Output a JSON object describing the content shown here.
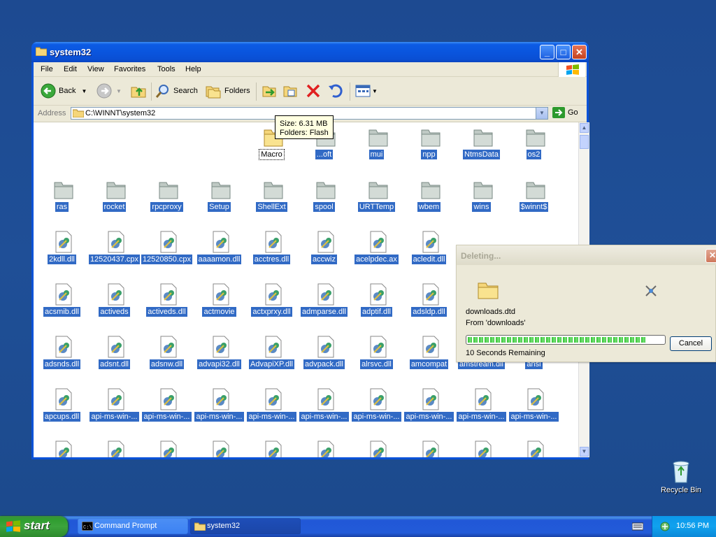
{
  "window": {
    "title": "system32",
    "menu": [
      "File",
      "Edit",
      "View",
      "Favorites",
      "Tools",
      "Help"
    ],
    "toolbar": {
      "back": "Back",
      "search": "Search",
      "folders": "Folders"
    },
    "address": {
      "label": "Address",
      "value": "C:\\WINNT\\system32",
      "go": "Go"
    }
  },
  "files": {
    "row0": [
      "Macro",
      "...oft",
      "mui",
      "npp",
      "NtmsData",
      "os2"
    ],
    "row1": [
      "ras",
      "rocket",
      "rpcproxy",
      "Setup",
      "ShellExt",
      "spool",
      "URTTemp",
      "wbem",
      "wins",
      "$winnt$"
    ],
    "row2": [
      "2kdll.dll",
      "12520437.cpx",
      "12520850.cpx",
      "aaaamon.dll",
      "acctres.dll",
      "accwiz",
      "acelpdec.ax",
      "acledit.dll"
    ],
    "row3": [
      "acsmib.dll",
      "activeds",
      "activeds.dll",
      "actmovie",
      "actxprxy.dll",
      "admparse.dll",
      "adptif.dll",
      "adsldp.dll"
    ],
    "row4": [
      "adsnds.dll",
      "adsnt.dll",
      "adsnw.dll",
      "advapi32.dll",
      "AdvapiXP.dll",
      "advpack.dll",
      "alrsvc.dll",
      "amcompat",
      "amstream.dll",
      "ansi"
    ],
    "row5": [
      "apcups.dll",
      "api-ms-win-...",
      "api-ms-win-...",
      "api-ms-win-...",
      "api-ms-win-...",
      "api-ms-win-...",
      "api-ms-win-...",
      "api-ms-win-...",
      "api-ms-win-...",
      "api-ms-win-..."
    ]
  },
  "tooltip": {
    "line1": "Size: 6.31 MB",
    "line2": "Folders: Flash"
  },
  "dialog": {
    "title": "Deleting...",
    "file": "downloads.dtd",
    "from": "From 'downloads'",
    "remaining": "10 Seconds Remaining",
    "cancel": "Cancel",
    "progress": 0.9
  },
  "desktop": {
    "recycle_bin": "Recycle Bin"
  },
  "taskbar": {
    "start": "start",
    "tasks": [
      "Command Prompt",
      "system32"
    ],
    "clock": "10:56 PM"
  }
}
